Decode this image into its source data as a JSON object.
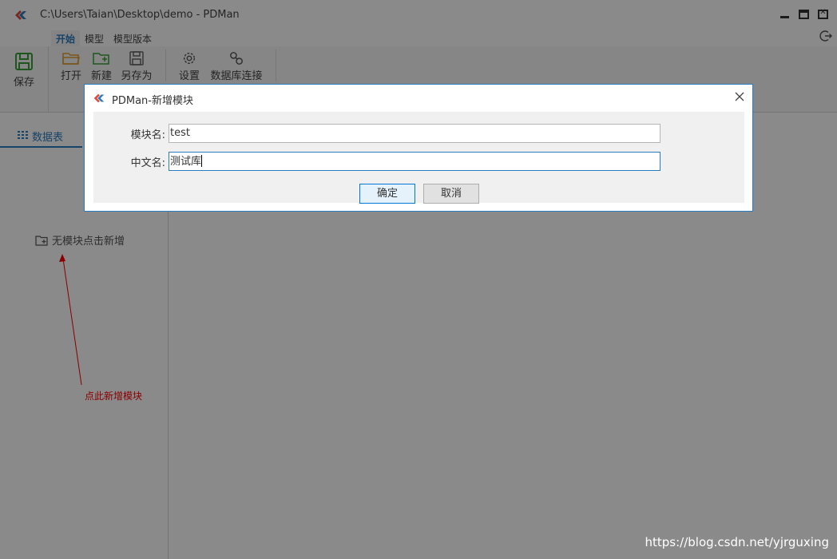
{
  "window": {
    "title": "C:\\Users\\Taian\\Desktop\\demo - PDMan"
  },
  "menu": {
    "tabs": [
      {
        "label": "开始",
        "active": true
      },
      {
        "label": "模型",
        "active": false
      },
      {
        "label": "模型版本",
        "active": false
      }
    ]
  },
  "ribbon": {
    "save": "保存",
    "open": "打开",
    "new": "新建",
    "save_as": "另存为",
    "settings": "设置",
    "db_connect": "数据库连接"
  },
  "sidebar": {
    "tab_label": "数据表",
    "empty_hint": "无模块点击新增",
    "annotation": "点此新增模块"
  },
  "dialog": {
    "title": "PDMan-新增模块",
    "module_name_label": "模块名:",
    "module_name_value": "test",
    "chinese_name_label": "中文名:",
    "chinese_name_value": "测试库",
    "ok_label": "确定",
    "cancel_label": "取消"
  },
  "watermark": "https://blog.csdn.net/yjrguxing",
  "colors": {
    "accent": "#2b7dbf",
    "annotation": "#ff0000",
    "overlay": "rgba(0,0,0,0.46)"
  }
}
